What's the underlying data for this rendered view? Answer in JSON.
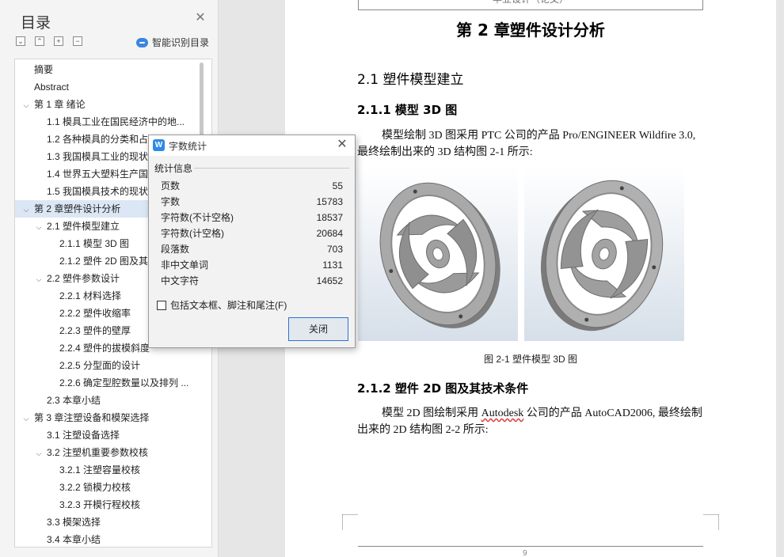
{
  "toc": {
    "title": "目录",
    "smart_toc_label": "智能识别目录",
    "toolbar": [
      "collapse-all",
      "expand-level",
      "add",
      "remove"
    ],
    "items": [
      {
        "label": "摘要",
        "level": 1,
        "chev": ""
      },
      {
        "label": "Abstract",
        "level": 1,
        "chev": ""
      },
      {
        "label": "第 1 章  绪论",
        "level": 1,
        "chev": "down"
      },
      {
        "label": "1.1  模具工业在国民经济中的地...",
        "level": 2,
        "chev": ""
      },
      {
        "label": "1.2  各种模具的分类和占",
        "level": 2,
        "chev": ""
      },
      {
        "label": "1.3  我国模具工业的现状",
        "level": 2,
        "chev": ""
      },
      {
        "label": "1.4  世界五大塑料生产国",
        "level": 2,
        "chev": ""
      },
      {
        "label": "1.5  我国模具技术的现状",
        "level": 2,
        "chev": ""
      },
      {
        "label": "第 2 章塑件设计分析",
        "level": 1,
        "chev": "down",
        "selected": true
      },
      {
        "label": "2.1  塑件模型建立",
        "level": 2,
        "chev": "down"
      },
      {
        "label": "2.1.1  模型 3D 图",
        "level": 3,
        "chev": ""
      },
      {
        "label": "2.1.2  塑件 2D 图及其",
        "level": 3,
        "chev": ""
      },
      {
        "label": "2.2  塑件参数设计",
        "level": 2,
        "chev": "down"
      },
      {
        "label": "2.2.1  材料选择",
        "level": 3,
        "chev": ""
      },
      {
        "label": "2.2.2  塑件收缩率",
        "level": 3,
        "chev": ""
      },
      {
        "label": "2.2.3  塑件的壁厚",
        "level": 3,
        "chev": ""
      },
      {
        "label": "2.2.4  塑件的拔模斜度",
        "level": 3,
        "chev": ""
      },
      {
        "label": "2.2.5  分型面的设计",
        "level": 3,
        "chev": ""
      },
      {
        "label": "2.2.6  确定型腔数量以及排列 ...",
        "level": 3,
        "chev": ""
      },
      {
        "label": "2.3  本章小结",
        "level": 2,
        "chev": ""
      },
      {
        "label": "第 3 章注塑设备和模架选择",
        "level": 1,
        "chev": "down"
      },
      {
        "label": "3.1  注塑设备选择",
        "level": 2,
        "chev": ""
      },
      {
        "label": "3.2  注塑机重要参数校核",
        "level": 2,
        "chev": "down"
      },
      {
        "label": "3.2.1  注塑容量校核",
        "level": 3,
        "chev": ""
      },
      {
        "label": "3.2.2  锁模力校核",
        "level": 3,
        "chev": ""
      },
      {
        "label": "3.2.3  开模行程校核",
        "level": 3,
        "chev": ""
      },
      {
        "label": "3.3  模架选择",
        "level": 2,
        "chev": ""
      },
      {
        "label": "3.4  本章小结",
        "level": 2,
        "chev": ""
      }
    ]
  },
  "document": {
    "header_text": "毕业设计（论文）",
    "chapter_title": "第 2 章塑件设计分析",
    "section_2_1": "2.1  塑件模型建立",
    "section_2_1_1": "2.1.1  模型 3D 图",
    "para1": "模型绘制 3D 图采用 PTC 公司的产品 Pro/ENGINEER Wildfire 3.0,最终绘制出来的 3D 结构图 2-1 所示:",
    "figure_caption": "图 2-1    塑件模型 3D 图",
    "section_2_1_2": "2.1.2  塑件 2D 图及其技术条件",
    "para2_before": "模型 2D 图绘制采用 ",
    "para2_flagged": "Autodesk",
    "para2_after": " 公司的产品 AutoCAD2006, 最终绘制出来的 2D 结构图 2-2 所示:",
    "page_number": "9"
  },
  "dialog": {
    "title": "字数统计",
    "group_label": "统计信息",
    "stats": [
      {
        "label": "页数",
        "value": "55"
      },
      {
        "label": "字数",
        "value": "15783"
      },
      {
        "label": "字符数(不计空格)",
        "value": "18537"
      },
      {
        "label": "字符数(计空格)",
        "value": "20684"
      },
      {
        "label": "段落数",
        "value": "703"
      },
      {
        "label": "非中文单词",
        "value": "1131"
      },
      {
        "label": "中文字符",
        "value": "14652"
      }
    ],
    "checkbox_label": "包括文本框、脚注和尾注(F)",
    "checkbox_checked": false,
    "close_label": "关闭"
  },
  "colors": {
    "accent": "#2e8ae6",
    "selection": "#dce7f5",
    "button_border": "#2b73d0"
  }
}
